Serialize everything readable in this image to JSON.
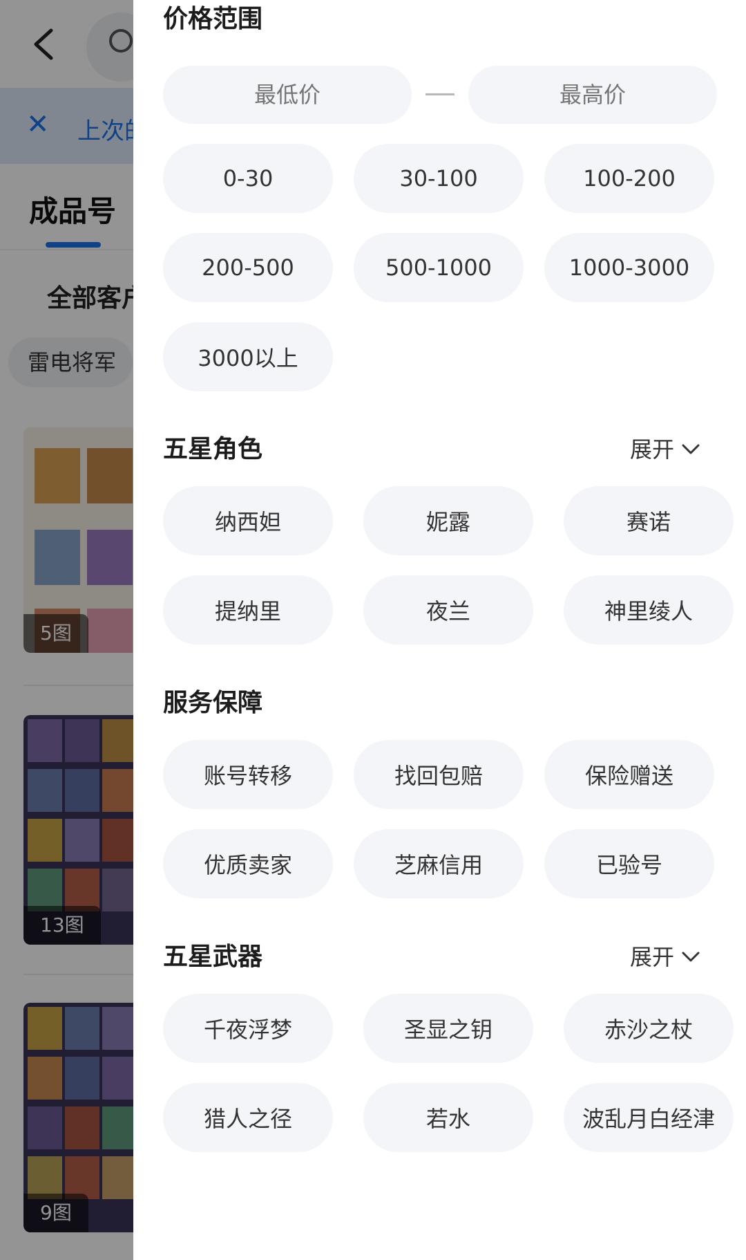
{
  "background": {
    "notice_text": "上次的",
    "tab_label": "成品号",
    "filter_label": "全部客户",
    "chip_label": "雷电将军",
    "cards": [
      {
        "count_label": "5图"
      },
      {
        "count_label": "13图"
      },
      {
        "count_label": "9图"
      }
    ]
  },
  "drawer": {
    "price": {
      "title": "价格范围",
      "min_placeholder": "最低价",
      "max_placeholder": "最高价",
      "ranges": [
        "0-30",
        "30-100",
        "100-200",
        "200-500",
        "500-1000",
        "1000-3000",
        "3000以上"
      ]
    },
    "characters": {
      "title": "五星角色",
      "expand_label": "展开",
      "options": [
        "纳西妲",
        "妮露",
        "赛诺",
        "提纳里",
        "夜兰",
        "神里绫人"
      ]
    },
    "services": {
      "title": "服务保障",
      "options": [
        "账号转移",
        "找回包赔",
        "保险赠送",
        "优质卖家",
        "芝麻信用",
        "已验号"
      ]
    },
    "weapons": {
      "title": "五星武器",
      "expand_label": "展开",
      "options": [
        "千夜浮梦",
        "圣显之钥",
        "赤沙之杖",
        "猎人之径",
        "若水",
        "波乱月白经津"
      ]
    }
  },
  "colors": {
    "accent": "#1a73e8",
    "chip_bg": "#f4f5f8",
    "overlay": "rgba(0,0,0,0.42)"
  }
}
